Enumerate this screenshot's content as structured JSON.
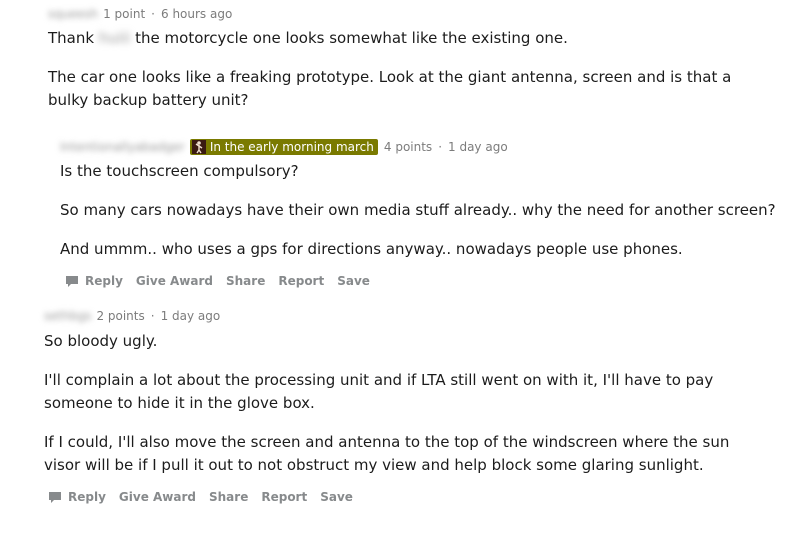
{
  "comment1": {
    "username": "squeesh",
    "points": "1 point",
    "time": "6 hours ago",
    "p1_pre": "Thank",
    "p1_blur": "huiii",
    "p1_post": "the motorcycle one looks somewhat like the existing one.",
    "p2": "The car one looks like a freaking prototype. Look at the giant antenna, screen and is that a bulky backup battery unit?"
  },
  "comment2": {
    "username": "Intentionallyabadger",
    "flair": "In the early morning march",
    "points": "4 points",
    "time": "1 day ago",
    "p1": "Is the touchscreen compulsory?",
    "p2": "So many cars nowadays have their own media stuff already.. why the need for another screen?",
    "p3": "And ummm.. who uses a gps for directions anyway.. nowadays people use phones."
  },
  "comment3": {
    "username": "sethbgs",
    "points": "2 points",
    "time": "1 day ago",
    "p1": "So bloody ugly.",
    "p2": "I'll complain a lot about the processing unit and if LTA still went on with it, I'll have to pay someone to hide it in the glove box.",
    "p3": "If I could, I'll also move the screen and antenna to the top of the windscreen where the sun visor will be if I pull it out to not obstruct my view and help block some glaring sunlight."
  },
  "actions": {
    "reply": "Reply",
    "give_award": "Give Award",
    "share": "Share",
    "report": "Report",
    "save": "Save"
  },
  "separator": "·",
  "icons": {
    "reply": "comment-icon",
    "flair": "flair-figure-icon"
  }
}
